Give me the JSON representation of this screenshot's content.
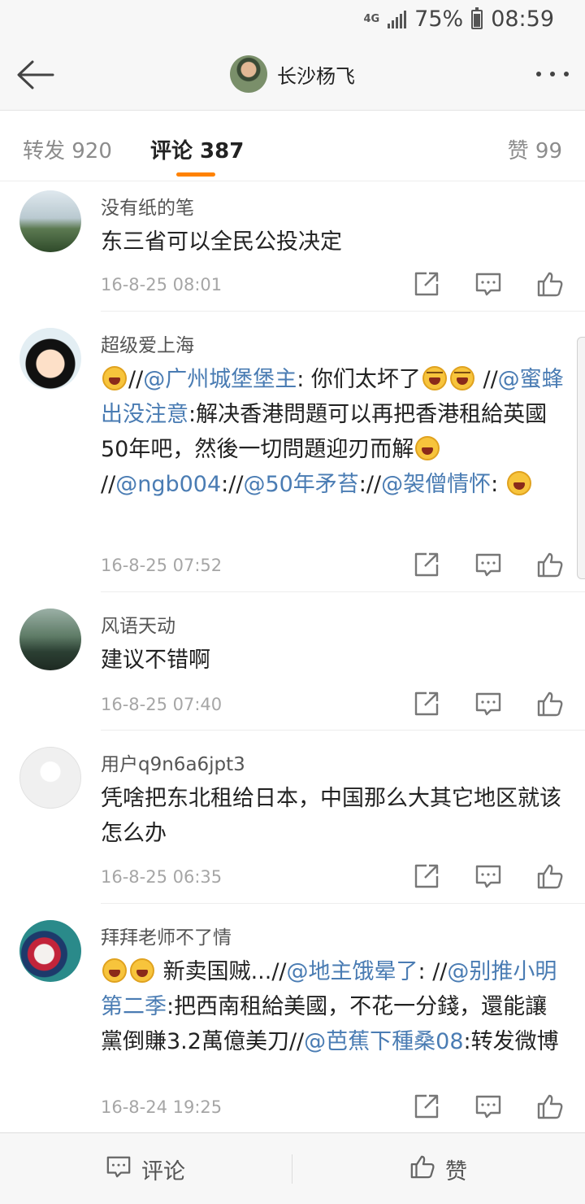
{
  "status_bar": {
    "network": "4G",
    "battery": "75%",
    "time": "08:59"
  },
  "header": {
    "title": "长沙杨飞",
    "back_icon": "back-arrow-icon",
    "more_icon": "more-dots-icon"
  },
  "tabs": {
    "repost": "转发 920",
    "comment": "评论 387",
    "like": "赞 99"
  },
  "comments": [
    {
      "name": "没有纸的笔",
      "segments": [
        {
          "t": "东三省可以全民公投决定"
        }
      ],
      "time": "16-8-25 08:01"
    },
    {
      "name": "超级爱上海",
      "segments": [
        {
          "emoji": "laugh"
        },
        {
          "t": "//"
        },
        {
          "at": "@广州城堡堡主"
        },
        {
          "t": ": 你们太坏了"
        },
        {
          "emoji": "cry"
        },
        {
          "emoji": "cry"
        },
        {
          "t": " //"
        },
        {
          "at": "@蜜蜂出没注意"
        },
        {
          "t": ":解决香港問題可以再把香港租給英國50年吧，然後一切問題迎刃而解"
        },
        {
          "emoji": "laugh"
        },
        {
          "t": " //"
        },
        {
          "at": "@ngb004"
        },
        {
          "t": "://"
        },
        {
          "at": "@50年矛苔"
        },
        {
          "t": "://"
        },
        {
          "at": "@袈僧情怀"
        },
        {
          "t": ": "
        },
        {
          "emoji": "laugh"
        }
      ],
      "time": "16-8-25 07:52"
    },
    {
      "name": "风语天动",
      "segments": [
        {
          "t": "建议不错啊"
        }
      ],
      "time": "16-8-25 07:40"
    },
    {
      "name": "用户q9n6a6jpt3",
      "segments": [
        {
          "t": "凭啥把东北租给日本，中国那么大其它地区就该怎么办"
        }
      ],
      "time": "16-8-25 06:35"
    },
    {
      "name": "拜拜老师不了情",
      "segments": [
        {
          "emoji": "laugh"
        },
        {
          "emoji": "laugh"
        },
        {
          "t": " 新卖国贼...//"
        },
        {
          "at": "@地主饿晕了"
        },
        {
          "t": ": //"
        },
        {
          "at": "@别推小明第二季"
        },
        {
          "t": ":把西南租給美國，不花一分錢，還能讓黨倒賺3.2萬億美刀//"
        },
        {
          "at": "@芭蕉下種桑08"
        },
        {
          "t": ":转发微博"
        }
      ],
      "time": "16-8-24 19:25"
    }
  ],
  "bottom_bar": {
    "comment": "评论",
    "like": "赞"
  }
}
